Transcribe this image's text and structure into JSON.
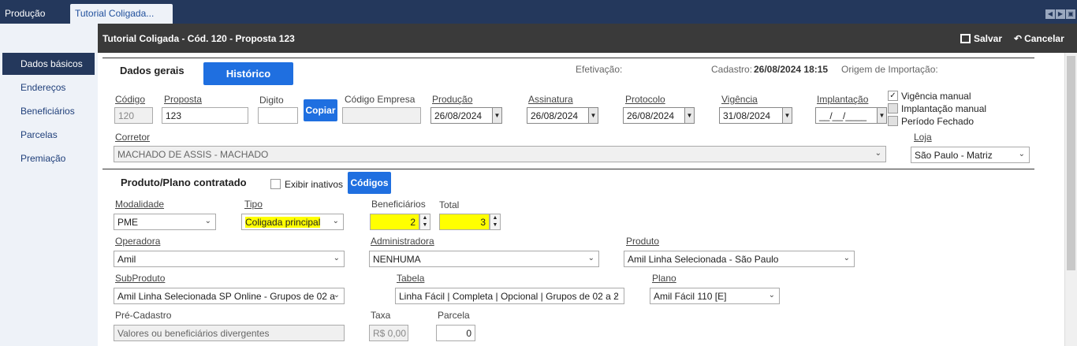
{
  "tabs": {
    "inactive": "Produção",
    "active": "Tutorial Coligada..."
  },
  "sidebar": {
    "items": [
      {
        "label": "Dados básicos"
      },
      {
        "label": "Endereços"
      },
      {
        "label": "Beneficiários"
      },
      {
        "label": "Parcelas"
      },
      {
        "label": "Premiação"
      }
    ]
  },
  "header": {
    "title": "Tutorial Coligada - Cód. 120 - Proposta 123",
    "save_label": "Salvar",
    "cancel_label": "Cancelar"
  },
  "dados_gerais": {
    "section_title": "Dados gerais",
    "historico_button": "Histórico",
    "efetivacao_label": "Efetivação:",
    "cadastro_label": "Cadastro:",
    "cadastro_value": "26/08/2024 18:15",
    "origem_label": "Origem de Importação:"
  },
  "fields": {
    "codigo": {
      "label": "Código",
      "value": "120"
    },
    "proposta": {
      "label": "Proposta",
      "value": "123"
    },
    "digito": {
      "label": "Digito",
      "value": ""
    },
    "copiar_button": "Copiar",
    "codigo_empresa": {
      "label": "Código Empresa",
      "value": ""
    },
    "producao": {
      "label": "Produção",
      "value": "26/08/2024"
    },
    "assinatura": {
      "label": "Assinatura",
      "value": "26/08/2024"
    },
    "protocolo": {
      "label": "Protocolo",
      "value": "26/08/2024"
    },
    "vigencia": {
      "label": "Vigência",
      "value": "31/08/2024"
    },
    "implantacao": {
      "label": "Implantação",
      "value": "__/__/____"
    },
    "vigencia_manual": {
      "label": "Vigência manual",
      "checked": true
    },
    "implantacao_manual": {
      "label": "Implantação manual",
      "checked": false
    },
    "periodo_fechado": {
      "label": "Período Fechado",
      "checked": false
    },
    "corretor": {
      "label": "Corretor",
      "value": "MACHADO DE ASSIS - MACHADO"
    },
    "loja": {
      "label": "Loja",
      "value": "São Paulo - Matriz"
    }
  },
  "produto": {
    "section_title": "Produto/Plano contratado",
    "exibir_inativos": "Exibir inativos",
    "codigos_button": "Códigos",
    "modalidade": {
      "label": "Modalidade",
      "value": "PME"
    },
    "tipo": {
      "label": "Tipo",
      "value": "Coligada principal"
    },
    "beneficiarios": {
      "label": "Beneficiários",
      "value": "2"
    },
    "total": {
      "label": "Total",
      "value": "3"
    },
    "operadora": {
      "label": "Operadora",
      "value": "Amil"
    },
    "administradora": {
      "label": "Administradora",
      "value": "NENHUMA"
    },
    "produto": {
      "label": "Produto",
      "value": "Amil Linha Selecionada - São Paulo"
    },
    "subproduto": {
      "label": "SubProduto",
      "value": "Amil Linha Selecionada SP Online - Grupos de 02 a"
    },
    "tabela": {
      "label": "Tabela",
      "value": "Linha Fácil | Completa | Opcional | Grupos de 02 a 2"
    },
    "plano": {
      "label": "Plano",
      "value": "Amil Fácil 110 [E]"
    },
    "pre_cadastro": {
      "label": "Pré-Cadastro",
      "value": "Valores ou beneficiários divergentes"
    },
    "taxa": {
      "label": "Taxa",
      "value": "R$ 0,00"
    },
    "parcela": {
      "label": "Parcela",
      "value": "0"
    }
  },
  "colors": {
    "topbar": "#24385c",
    "header": "#3a3a3a",
    "accent": "#1f6fe0",
    "highlight": "#ffff00"
  }
}
